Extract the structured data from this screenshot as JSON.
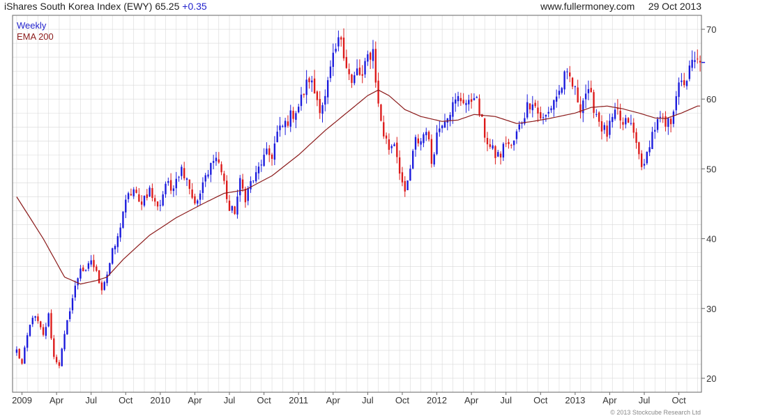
{
  "header": {
    "title": "iShares South Korea Index (EWY)",
    "last_price": "65.25",
    "change": "+0.35",
    "source": "www.fullermoney.com",
    "date": "29 Oct 2013"
  },
  "legend": {
    "weekly_label": "Weekly",
    "ema_label": "EMA 200"
  },
  "copyright": "© 2013 Stockcube Research Ltd",
  "colors": {
    "up": "#1a1adc",
    "down": "#dc1a1a",
    "ema": "#8b1a1a",
    "grid": "#d8d8d8",
    "axis": "#666666"
  },
  "chart_data": {
    "type": "candlestick",
    "title": "iShares South Korea Index (EWY)",
    "interval": "Weekly",
    "ylim": [
      18,
      72
    ],
    "y_ticks": [
      20,
      30,
      40,
      50,
      60,
      70
    ],
    "y_tick_labels": [
      "20",
      "30",
      "40",
      "50",
      "60",
      "70"
    ],
    "x_ticks": [
      {
        "label": "2009",
        "week": 2
      },
      {
        "label": "Apr",
        "week": 15
      },
      {
        "label": "Jul",
        "week": 28
      },
      {
        "label": "Oct",
        "week": 41
      },
      {
        "label": "2010",
        "week": 54
      },
      {
        "label": "Apr",
        "week": 67
      },
      {
        "label": "Jul",
        "week": 80
      },
      {
        "label": "Oct",
        "week": 93
      },
      {
        "label": "2011",
        "week": 106
      },
      {
        "label": "Apr",
        "week": 119
      },
      {
        "label": "Jul",
        "week": 132
      },
      {
        "label": "Oct",
        "week": 145
      },
      {
        "label": "2012",
        "week": 158
      },
      {
        "label": "Apr",
        "week": 171
      },
      {
        "label": "Jul",
        "week": 184
      },
      {
        "label": "Oct",
        "week": 197
      },
      {
        "label": "2013",
        "week": 210
      },
      {
        "label": "Apr",
        "week": 223
      },
      {
        "label": "Jul",
        "week": 236
      },
      {
        "label": "Oct",
        "week": 249
      }
    ],
    "week_count": 258,
    "close_anchors": [
      [
        0,
        24
      ],
      [
        2,
        22
      ],
      [
        4,
        26
      ],
      [
        6,
        29
      ],
      [
        8,
        28
      ],
      [
        10,
        26
      ],
      [
        12,
        29
      ],
      [
        14,
        23
      ],
      [
        16,
        22
      ],
      [
        18,
        26
      ],
      [
        20,
        30
      ],
      [
        22,
        33
      ],
      [
        24,
        36
      ],
      [
        26,
        35
      ],
      [
        28,
        37
      ],
      [
        30,
        35
      ],
      [
        32,
        33
      ],
      [
        34,
        35
      ],
      [
        36,
        38
      ],
      [
        38,
        40
      ],
      [
        40,
        44
      ],
      [
        42,
        46
      ],
      [
        44,
        47
      ],
      [
        46,
        45
      ],
      [
        48,
        46
      ],
      [
        50,
        47
      ],
      [
        52,
        45
      ],
      [
        54,
        45
      ],
      [
        56,
        48
      ],
      [
        58,
        47
      ],
      [
        60,
        49
      ],
      [
        62,
        50
      ],
      [
        64,
        49
      ],
      [
        66,
        46
      ],
      [
        68,
        45
      ],
      [
        70,
        48
      ],
      [
        72,
        49
      ],
      [
        74,
        52
      ],
      [
        76,
        51
      ],
      [
        78,
        48
      ],
      [
        80,
        44
      ],
      [
        82,
        44
      ],
      [
        84,
        48
      ],
      [
        86,
        46
      ],
      [
        88,
        48
      ],
      [
        90,
        49
      ],
      [
        92,
        51
      ],
      [
        94,
        52
      ],
      [
        96,
        52
      ],
      [
        98,
        55
      ],
      [
        100,
        56
      ],
      [
        102,
        57
      ],
      [
        104,
        58
      ],
      [
        106,
        59
      ],
      [
        108,
        61
      ],
      [
        110,
        63
      ],
      [
        112,
        61
      ],
      [
        114,
        59
      ],
      [
        116,
        60
      ],
      [
        118,
        64
      ],
      [
        120,
        67
      ],
      [
        122,
        69
      ],
      [
        124,
        65
      ],
      [
        126,
        62
      ],
      [
        128,
        64
      ],
      [
        130,
        63
      ],
      [
        132,
        66
      ],
      [
        134,
        67
      ],
      [
        136,
        59
      ],
      [
        138,
        55
      ],
      [
        140,
        53
      ],
      [
        142,
        54
      ],
      [
        144,
        50
      ],
      [
        146,
        46
      ],
      [
        148,
        50
      ],
      [
        150,
        54
      ],
      [
        152,
        54
      ],
      [
        154,
        56
      ],
      [
        156,
        51
      ],
      [
        158,
        55
      ],
      [
        160,
        57
      ],
      [
        162,
        58
      ],
      [
        164,
        59
      ],
      [
        166,
        60
      ],
      [
        168,
        60
      ],
      [
        170,
        59
      ],
      [
        172,
        61
      ],
      [
        174,
        58
      ],
      [
        176,
        55
      ],
      [
        178,
        53
      ],
      [
        180,
        52
      ],
      [
        182,
        52
      ],
      [
        184,
        54
      ],
      [
        186,
        53
      ],
      [
        188,
        55
      ],
      [
        190,
        57
      ],
      [
        192,
        59
      ],
      [
        194,
        60
      ],
      [
        196,
        58
      ],
      [
        198,
        57
      ],
      [
        200,
        58
      ],
      [
        202,
        60
      ],
      [
        204,
        61
      ],
      [
        206,
        63
      ],
      [
        208,
        63
      ],
      [
        210,
        61
      ],
      [
        212,
        59
      ],
      [
        214,
        61
      ],
      [
        216,
        60
      ],
      [
        218,
        58
      ],
      [
        220,
        56
      ],
      [
        222,
        55
      ],
      [
        224,
        57
      ],
      [
        226,
        58
      ],
      [
        228,
        56
      ],
      [
        230,
        57
      ],
      [
        232,
        55
      ],
      [
        234,
        52
      ],
      [
        236,
        50
      ],
      [
        238,
        54
      ],
      [
        240,
        56
      ],
      [
        242,
        57
      ],
      [
        244,
        56
      ],
      [
        246,
        57
      ],
      [
        248,
        61
      ],
      [
        250,
        62
      ],
      [
        252,
        63
      ],
      [
        254,
        65
      ],
      [
        256,
        65.25
      ]
    ],
    "ema_anchors": [
      [
        0,
        46
      ],
      [
        10,
        40
      ],
      [
        18,
        34.5
      ],
      [
        24,
        33.5
      ],
      [
        30,
        34
      ],
      [
        34,
        34.5
      ],
      [
        40,
        37
      ],
      [
        50,
        40.5
      ],
      [
        60,
        43
      ],
      [
        70,
        45
      ],
      [
        78,
        46.5
      ],
      [
        86,
        47
      ],
      [
        96,
        49
      ],
      [
        106,
        52
      ],
      [
        116,
        55.5
      ],
      [
        124,
        58
      ],
      [
        132,
        60.5
      ],
      [
        136,
        61.3
      ],
      [
        140,
        60.5
      ],
      [
        146,
        58.5
      ],
      [
        152,
        57.5
      ],
      [
        160,
        56.8
      ],
      [
        166,
        57
      ],
      [
        172,
        57.8
      ],
      [
        180,
        57.5
      ],
      [
        188,
        56.5
      ],
      [
        194,
        56.8
      ],
      [
        200,
        57.2
      ],
      [
        210,
        58
      ],
      [
        216,
        58.8
      ],
      [
        222,
        59
      ],
      [
        228,
        58.6
      ],
      [
        234,
        58
      ],
      [
        240,
        57.3
      ],
      [
        244,
        57.2
      ],
      [
        250,
        58
      ],
      [
        256,
        59
      ]
    ]
  }
}
